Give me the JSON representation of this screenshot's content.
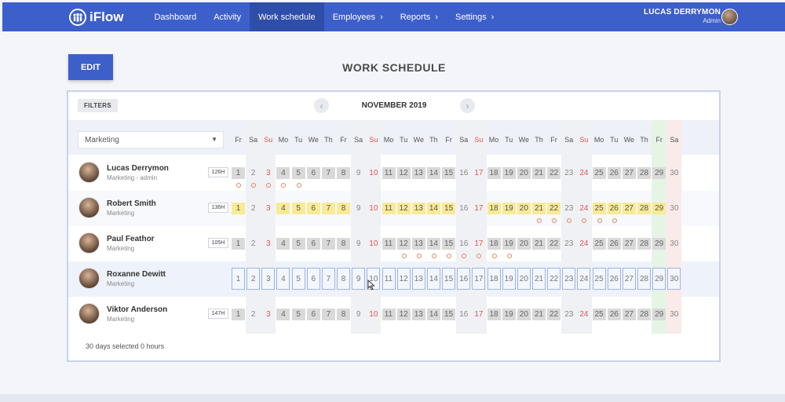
{
  "app": {
    "name": "iFlow"
  },
  "nav": {
    "items": [
      {
        "label": "Dashboard",
        "active": false,
        "dropdown": false
      },
      {
        "label": "Activity",
        "active": false,
        "dropdown": false
      },
      {
        "label": "Work schedule",
        "active": true,
        "dropdown": false
      },
      {
        "label": "Employees",
        "active": false,
        "dropdown": true
      },
      {
        "label": "Reports",
        "active": false,
        "dropdown": true
      },
      {
        "label": "Settings",
        "active": false,
        "dropdown": true
      }
    ]
  },
  "user": {
    "name": "LUCAS DERRYMON",
    "role": "Admin"
  },
  "page": {
    "title": "WORK SCHEDULE",
    "edit_label": "EDIT"
  },
  "schedule": {
    "filters_label": "FILTERS",
    "month": "NOVEMBER 2019",
    "department": "Marketing",
    "day_names": [
      "Fr",
      "Sa",
      "Su",
      "Mo",
      "Tu",
      "We",
      "Th",
      "Fr",
      "Sa",
      "Su",
      "Mo",
      "Tu",
      "We",
      "Th",
      "Fr",
      "Sa",
      "Su",
      "Mo",
      "Tu",
      "We",
      "Th",
      "Fr",
      "Sa",
      "Su",
      "Mo",
      "Tu",
      "We",
      "Th",
      "Fr",
      "Sa"
    ],
    "sundays": [
      3,
      10,
      17,
      24
    ],
    "status_text": "30 days selected 0 hours",
    "employees": [
      {
        "name": "Lucas Derrymon",
        "subtitle": "Marketing - admin",
        "hours": "126H",
        "work_days": [
          1,
          4,
          5,
          6,
          7,
          8,
          11,
          12,
          13,
          14,
          15,
          18,
          19,
          20,
          21,
          22,
          25,
          26,
          27,
          28,
          29
        ],
        "highlight_days": [],
        "selected_days": [],
        "marked_days": [
          1,
          2,
          3,
          4,
          5
        ]
      },
      {
        "name": "Robert Smith",
        "subtitle": "Marketing",
        "hours": "136H",
        "work_days": [],
        "highlight_days": [
          1,
          4,
          5,
          6,
          7,
          8,
          11,
          12,
          13,
          14,
          15,
          18,
          19,
          20,
          21,
          22,
          25,
          26,
          27,
          28,
          29
        ],
        "selected_days": [],
        "marked_days": [
          21,
          22,
          23,
          24,
          25,
          26
        ]
      },
      {
        "name": "Paul Feathor",
        "subtitle": "Marketing",
        "hours": "105H",
        "work_days": [
          1,
          4,
          5,
          6,
          7,
          8,
          11,
          12,
          13,
          14,
          15,
          18,
          19,
          20,
          21,
          22,
          25,
          26,
          27,
          28,
          29
        ],
        "highlight_days": [],
        "selected_days": [],
        "marked_days": [
          12,
          13,
          14,
          15,
          16,
          17,
          18,
          19
        ]
      },
      {
        "name": "Roxanne Dewitt",
        "subtitle": "Marketing",
        "hours": "",
        "work_days": [],
        "highlight_days": [],
        "selected_days": [
          1,
          2,
          3,
          4,
          5,
          6,
          7,
          8,
          9,
          10,
          11,
          12,
          13,
          14,
          15,
          16,
          17,
          18,
          19,
          20,
          21,
          22,
          23,
          24,
          25,
          26,
          27,
          28,
          29,
          30
        ],
        "marked_days": []
      },
      {
        "name": "Viktor Anderson",
        "subtitle": "Marketing",
        "hours": "147H",
        "work_days": [
          1,
          4,
          5,
          6,
          7,
          8,
          11,
          12,
          13,
          14,
          15,
          18,
          19,
          20,
          21,
          22,
          25,
          26,
          27,
          28,
          29
        ],
        "highlight_days": [],
        "selected_days": [],
        "marked_days": []
      }
    ]
  },
  "colors": {
    "accent": "#3d5fc9",
    "workday": "#d9d9d9",
    "highlight": "#f9ea95",
    "sunday": "#e05555",
    "mark": "#e4875a"
  }
}
